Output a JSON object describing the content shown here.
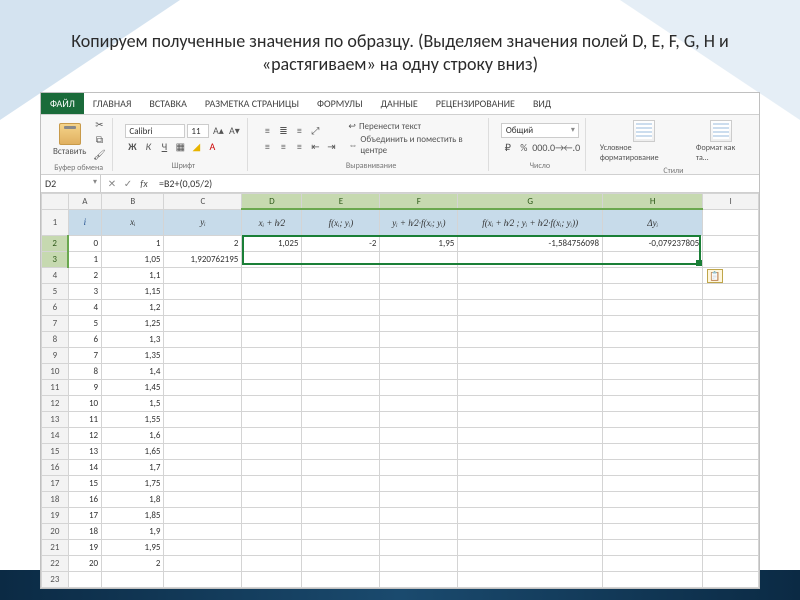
{
  "slide": {
    "title": "Копируем полученные значения по образцу. (Выделяем значения полей D, E, F, G, H и «растягиваем» на одну строку вниз)"
  },
  "tabs": [
    "ФАЙЛ",
    "ГЛАВНАЯ",
    "ВСТАВКА",
    "РАЗМЕТКА СТРАНИЦЫ",
    "ФОРМУЛЫ",
    "ДАННЫЕ",
    "РЕЦЕНЗИРОВАНИЕ",
    "ВИД"
  ],
  "ribbon": {
    "paste": "Вставить",
    "font_name": "Calibri",
    "font_size": "11",
    "wrap": "Перенести текст",
    "merge": "Объединить и поместить в центре",
    "number_format": "Общий",
    "cond_format": "Условное форматирование",
    "format_table": "Формат как та…",
    "groups": {
      "clipboard": "Буфер обмена",
      "font": "Шрифт",
      "align": "Выравнивание",
      "number": "Число",
      "styles": "Стили"
    }
  },
  "formula_bar": {
    "cell": "D2",
    "formula": "=B2+(0,05/2)"
  },
  "cols": [
    "A",
    "B",
    "C",
    "D",
    "E",
    "F",
    "G",
    "H",
    "I"
  ],
  "headers": [
    "i",
    "xᵢ",
    "yᵢ",
    "xᵢ + h⁄2",
    "f(xᵢ; yᵢ)",
    "yᵢ + h⁄2·f(xᵢ; yᵢ)",
    "f(xᵢ + h⁄2 ; yᵢ + h⁄2·f(xᵢ; yᵢ))",
    "Δyᵢ"
  ],
  "rows": [
    {
      "n": 2,
      "i": "0",
      "x": "1",
      "y": "2",
      "d": "1,025",
      "e": "-2",
      "f": "1,95",
      "g": "-1,584756098",
      "h": "-0,079237805"
    },
    {
      "n": 3,
      "i": "1",
      "x": "1,05",
      "y": "1,920762195",
      "d": "",
      "e": "",
      "f": "",
      "g": "",
      "h": ""
    },
    {
      "n": 4,
      "i": "2",
      "x": "1,1",
      "y": "",
      "d": "",
      "e": "",
      "f": "",
      "g": "",
      "h": ""
    },
    {
      "n": 5,
      "i": "3",
      "x": "1,15",
      "y": "",
      "d": "",
      "e": "",
      "f": "",
      "g": "",
      "h": ""
    },
    {
      "n": 6,
      "i": "4",
      "x": "1,2",
      "y": "",
      "d": "",
      "e": "",
      "f": "",
      "g": "",
      "h": ""
    },
    {
      "n": 7,
      "i": "5",
      "x": "1,25",
      "y": "",
      "d": "",
      "e": "",
      "f": "",
      "g": "",
      "h": ""
    },
    {
      "n": 8,
      "i": "6",
      "x": "1,3",
      "y": "",
      "d": "",
      "e": "",
      "f": "",
      "g": "",
      "h": ""
    },
    {
      "n": 9,
      "i": "7",
      "x": "1,35",
      "y": "",
      "d": "",
      "e": "",
      "f": "",
      "g": "",
      "h": ""
    },
    {
      "n": 10,
      "i": "8",
      "x": "1,4",
      "y": "",
      "d": "",
      "e": "",
      "f": "",
      "g": "",
      "h": ""
    },
    {
      "n": 11,
      "i": "9",
      "x": "1,45",
      "y": "",
      "d": "",
      "e": "",
      "f": "",
      "g": "",
      "h": ""
    },
    {
      "n": 12,
      "i": "10",
      "x": "1,5",
      "y": "",
      "d": "",
      "e": "",
      "f": "",
      "g": "",
      "h": ""
    },
    {
      "n": 13,
      "i": "11",
      "x": "1,55",
      "y": "",
      "d": "",
      "e": "",
      "f": "",
      "g": "",
      "h": ""
    },
    {
      "n": 14,
      "i": "12",
      "x": "1,6",
      "y": "",
      "d": "",
      "e": "",
      "f": "",
      "g": "",
      "h": ""
    },
    {
      "n": 15,
      "i": "13",
      "x": "1,65",
      "y": "",
      "d": "",
      "e": "",
      "f": "",
      "g": "",
      "h": ""
    },
    {
      "n": 16,
      "i": "14",
      "x": "1,7",
      "y": "",
      "d": "",
      "e": "",
      "f": "",
      "g": "",
      "h": ""
    },
    {
      "n": 17,
      "i": "15",
      "x": "1,75",
      "y": "",
      "d": "",
      "e": "",
      "f": "",
      "g": "",
      "h": ""
    },
    {
      "n": 18,
      "i": "16",
      "x": "1,8",
      "y": "",
      "d": "",
      "e": "",
      "f": "",
      "g": "",
      "h": ""
    },
    {
      "n": 19,
      "i": "17",
      "x": "1,85",
      "y": "",
      "d": "",
      "e": "",
      "f": "",
      "g": "",
      "h": ""
    },
    {
      "n": 20,
      "i": "18",
      "x": "1,9",
      "y": "",
      "d": "",
      "e": "",
      "f": "",
      "g": "",
      "h": ""
    },
    {
      "n": 21,
      "i": "19",
      "x": "1,95",
      "y": "",
      "d": "",
      "e": "",
      "f": "",
      "g": "",
      "h": ""
    },
    {
      "n": 22,
      "i": "20",
      "x": "2",
      "y": "",
      "d": "",
      "e": "",
      "f": "",
      "g": "",
      "h": ""
    },
    {
      "n": 23,
      "i": "",
      "x": "",
      "y": "",
      "d": "",
      "e": "",
      "f": "",
      "g": "",
      "h": ""
    }
  ],
  "selection": {
    "top_row": 2,
    "bottom_row": 3,
    "left_col": 4,
    "right_col": 8
  }
}
